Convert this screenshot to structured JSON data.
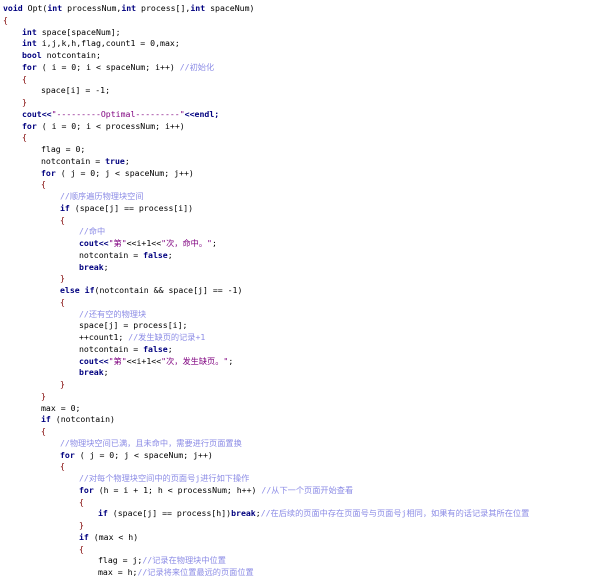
{
  "editor": {
    "lines": [
      {
        "indent": 0,
        "segments": [
          {
            "t": "void",
            "c": "kw"
          },
          {
            "t": " Opt(",
            "c": "op"
          },
          {
            "t": "int",
            "c": "kw"
          },
          {
            "t": " processNum,",
            "c": "op"
          },
          {
            "t": "int",
            "c": "kw"
          },
          {
            "t": " process[],",
            "c": "op"
          },
          {
            "t": "int",
            "c": "kw"
          },
          {
            "t": " spaceNum)",
            "c": "op"
          }
        ]
      },
      {
        "indent": 0,
        "segments": [
          {
            "t": "{",
            "c": "bp"
          }
        ]
      },
      {
        "indent": 1,
        "segments": [
          {
            "t": "int",
            "c": "kw"
          },
          {
            "t": " space[spaceNum];",
            "c": "op"
          }
        ]
      },
      {
        "indent": 1,
        "segments": [
          {
            "t": "int",
            "c": "kw"
          },
          {
            "t": " i,j,k,h,flag,count1 = 0,max;",
            "c": "op"
          }
        ]
      },
      {
        "indent": 1,
        "segments": [
          {
            "t": "bool",
            "c": "kw"
          },
          {
            "t": " notcontain;",
            "c": "op"
          }
        ]
      },
      {
        "indent": 1,
        "segments": [
          {
            "t": "for",
            "c": "kw"
          },
          {
            "t": " ( i = 0; i < spaceNum; i++) ",
            "c": "op"
          },
          {
            "t": "//初始化",
            "c": "cm"
          }
        ]
      },
      {
        "indent": 1,
        "segments": [
          {
            "t": "{",
            "c": "bp"
          }
        ]
      },
      {
        "indent": 2,
        "segments": [
          {
            "t": "space[i] = -1;",
            "c": "op"
          }
        ]
      },
      {
        "indent": 1,
        "segments": [
          {
            "t": "}",
            "c": "bp"
          }
        ]
      },
      {
        "indent": 1,
        "segments": [
          {
            "t": "cout<<",
            "c": "kw"
          },
          {
            "t": "\"---------Optimal---------\"",
            "c": "str"
          },
          {
            "t": "<<endl;",
            "c": "kw"
          }
        ]
      },
      {
        "indent": 1,
        "segments": [
          {
            "t": "for",
            "c": "kw"
          },
          {
            "t": " ( i = 0; i < processNum; i++)",
            "c": "op"
          }
        ]
      },
      {
        "indent": 1,
        "segments": [
          {
            "t": "{",
            "c": "bp"
          }
        ]
      },
      {
        "indent": 2,
        "segments": [
          {
            "t": "flag = 0;",
            "c": "op"
          }
        ]
      },
      {
        "indent": 2,
        "segments": [
          {
            "t": "notcontain = ",
            "c": "op"
          },
          {
            "t": "true",
            "c": "kw"
          },
          {
            "t": ";",
            "c": "op"
          }
        ]
      },
      {
        "indent": 2,
        "segments": [
          {
            "t": "for",
            "c": "kw"
          },
          {
            "t": " ( j = 0; j < spaceNum; j++)",
            "c": "op"
          }
        ]
      },
      {
        "indent": 2,
        "segments": [
          {
            "t": "{",
            "c": "bp"
          }
        ]
      },
      {
        "indent": 3,
        "segments": [
          {
            "t": "//顺序遍历物理块空间",
            "c": "cm"
          }
        ]
      },
      {
        "indent": 3,
        "segments": [
          {
            "t": "if",
            "c": "kw"
          },
          {
            "t": " (space[j] == process[i])",
            "c": "op"
          }
        ]
      },
      {
        "indent": 3,
        "segments": [
          {
            "t": "{",
            "c": "bp"
          }
        ]
      },
      {
        "indent": 4,
        "segments": [
          {
            "t": "//命中",
            "c": "cm"
          }
        ]
      },
      {
        "indent": 4,
        "segments": [
          {
            "t": "cout<<",
            "c": "kw"
          },
          {
            "t": "\"第\"",
            "c": "str"
          },
          {
            "t": "<<i+1<<",
            "c": "op"
          },
          {
            "t": "\"次，命中。\"",
            "c": "str"
          },
          {
            "t": ";",
            "c": "op"
          }
        ]
      },
      {
        "indent": 4,
        "segments": [
          {
            "t": "notcontain = ",
            "c": "op"
          },
          {
            "t": "false",
            "c": "kw"
          },
          {
            "t": ";",
            "c": "op"
          }
        ]
      },
      {
        "indent": 4,
        "segments": [
          {
            "t": "break",
            "c": "kw"
          },
          {
            "t": ";",
            "c": "op"
          }
        ]
      },
      {
        "indent": 3,
        "segments": [
          {
            "t": "}",
            "c": "bp"
          }
        ]
      },
      {
        "indent": 3,
        "segments": [
          {
            "t": "else if",
            "c": "kw"
          },
          {
            "t": "(notcontain && space[j] == -1)",
            "c": "op"
          }
        ]
      },
      {
        "indent": 3,
        "segments": [
          {
            "t": "{",
            "c": "bp"
          }
        ]
      },
      {
        "indent": 4,
        "segments": [
          {
            "t": "//还有空的物理块",
            "c": "cm"
          }
        ]
      },
      {
        "indent": 4,
        "segments": [
          {
            "t": "space[j] = process[i];",
            "c": "op"
          }
        ]
      },
      {
        "indent": 4,
        "segments": [
          {
            "t": "++count1; ",
            "c": "op"
          },
          {
            "t": "//发生缺页的记录+1",
            "c": "cm"
          }
        ]
      },
      {
        "indent": 4,
        "segments": [
          {
            "t": "notcontain = ",
            "c": "op"
          },
          {
            "t": "false",
            "c": "kw"
          },
          {
            "t": ";",
            "c": "op"
          }
        ]
      },
      {
        "indent": 4,
        "segments": [
          {
            "t": "cout<<",
            "c": "kw"
          },
          {
            "t": "\"第\"",
            "c": "str"
          },
          {
            "t": "<<i+1<<",
            "c": "op"
          },
          {
            "t": "\"次，发生缺页。\"",
            "c": "str"
          },
          {
            "t": ";",
            "c": "op"
          }
        ]
      },
      {
        "indent": 4,
        "segments": [
          {
            "t": "break",
            "c": "kw"
          },
          {
            "t": ";",
            "c": "op"
          }
        ]
      },
      {
        "indent": 3,
        "segments": [
          {
            "t": "}",
            "c": "bp"
          }
        ]
      },
      {
        "indent": 2,
        "segments": [
          {
            "t": "}",
            "c": "bp"
          }
        ]
      },
      {
        "indent": 2,
        "segments": [
          {
            "t": "max = 0;",
            "c": "op"
          }
        ]
      },
      {
        "indent": 2,
        "segments": [
          {
            "t": "if",
            "c": "kw"
          },
          {
            "t": " (notcontain)",
            "c": "op"
          }
        ]
      },
      {
        "indent": 2,
        "segments": [
          {
            "t": "{",
            "c": "bp"
          }
        ]
      },
      {
        "indent": 3,
        "segments": [
          {
            "t": "//物理块空间已满，且未命中，需要进行页面置换",
            "c": "cm"
          }
        ]
      },
      {
        "indent": 3,
        "segments": [
          {
            "t": "for",
            "c": "kw"
          },
          {
            "t": " ( j = 0; j < spaceNum; j++)",
            "c": "op"
          }
        ]
      },
      {
        "indent": 3,
        "segments": [
          {
            "t": "{",
            "c": "bp"
          }
        ]
      },
      {
        "indent": 4,
        "segments": [
          {
            "t": "//对每个物理块空间中的页面号j进行如下操作",
            "c": "cm"
          }
        ]
      },
      {
        "indent": 4,
        "segments": [
          {
            "t": "for",
            "c": "kw"
          },
          {
            "t": " (h = i + 1; h < processNum; h++) ",
            "c": "op"
          },
          {
            "t": "//从下一个页面开始查看",
            "c": "cm"
          }
        ]
      },
      {
        "indent": 4,
        "segments": [
          {
            "t": "{",
            "c": "bp"
          }
        ]
      },
      {
        "indent": 5,
        "segments": [
          {
            "t": "if",
            "c": "kw"
          },
          {
            "t": " (space[j] == process[h])",
            "c": "op"
          },
          {
            "t": "break",
            "c": "kw"
          },
          {
            "t": ";",
            "c": "op"
          },
          {
            "t": "//在后续的页面中存在页面号与页面号j相同，如果有的话记录其所在位置",
            "c": "cm"
          }
        ]
      },
      {
        "indent": 4,
        "segments": [
          {
            "t": "}",
            "c": "bp"
          }
        ]
      },
      {
        "indent": 4,
        "segments": [
          {
            "t": "if",
            "c": "kw"
          },
          {
            "t": " (max < h)",
            "c": "op"
          }
        ]
      },
      {
        "indent": 4,
        "segments": [
          {
            "t": "{",
            "c": "bp"
          }
        ]
      },
      {
        "indent": 5,
        "segments": [
          {
            "t": "flag = j;",
            "c": "op"
          },
          {
            "t": "//记录在物理块中位置",
            "c": "cm"
          }
        ]
      },
      {
        "indent": 5,
        "segments": [
          {
            "t": "max = h;",
            "c": "op"
          },
          {
            "t": "//记录将来位置最远的页面位置",
            "c": "cm"
          }
        ]
      }
    ]
  },
  "colors": {
    "keyword": "#00007f",
    "string": "#7f007f",
    "comment": "#8c8ce6",
    "text": "#000000",
    "brace": "#7f0000",
    "background": "#ffffff"
  }
}
